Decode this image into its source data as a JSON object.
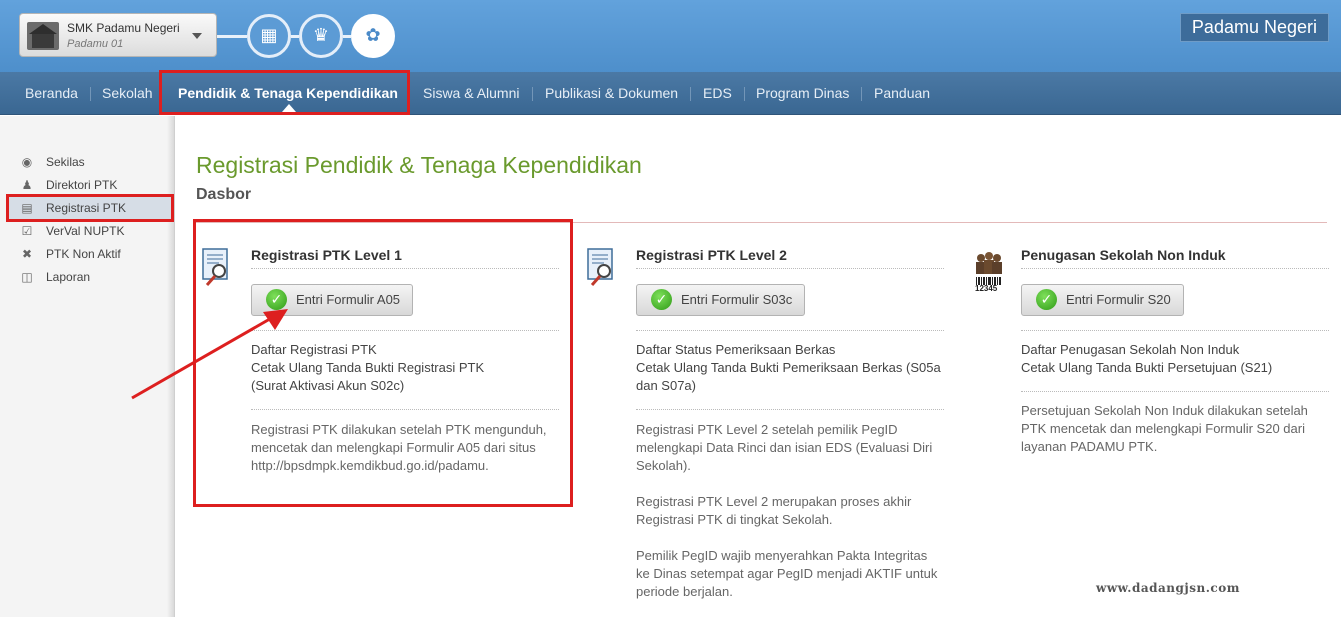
{
  "header": {
    "school_name": "SMK Padamu Negeri",
    "school_sub": "Padamu 01",
    "brand": "Padamu Negeri",
    "steps": [
      {
        "icon": "building-icon",
        "active": false
      },
      {
        "icon": "crown-icon",
        "active": false
      },
      {
        "icon": "badge-icon",
        "active": true
      }
    ]
  },
  "nav": {
    "items": [
      {
        "label": "Beranda"
      },
      {
        "label": "Sekolah"
      },
      {
        "label": "Pendidik & Tenaga Kependidikan",
        "active": true
      },
      {
        "label": "Siswa & Alumni"
      },
      {
        "label": "Publikasi & Dokumen"
      },
      {
        "label": "EDS"
      },
      {
        "label": "Program Dinas"
      },
      {
        "label": "Panduan"
      }
    ]
  },
  "sidebar": {
    "items": [
      {
        "label": "Sekilas",
        "icon": "info-icon"
      },
      {
        "label": "Direktori PTK",
        "icon": "person-icon"
      },
      {
        "label": "Registrasi PTK",
        "icon": "id-card-icon",
        "active": true
      },
      {
        "label": "VerVal NUPTK",
        "icon": "clipboard-check-icon"
      },
      {
        "label": "PTK Non Aktif",
        "icon": "cross-icon"
      },
      {
        "label": "Laporan",
        "icon": "document-icon"
      }
    ]
  },
  "main": {
    "title": "Registrasi Pendidik & Tenaga Kependidikan",
    "section": "Dasbor",
    "cards": [
      {
        "title": "Registrasi PTK Level 1",
        "button": "Entri Formulir A05",
        "links": [
          "Daftar Registrasi PTK",
          "Cetak Ulang Tanda Bukti Registrasi PTK",
          "(Surat Aktivasi Akun S02c)"
        ],
        "desc": [
          "Registrasi PTK dilakukan setelah PTK mengunduh,",
          "mencetak dan melengkapi Formulir A05 dari situs",
          "http://bpsdmpk.kemdikbud.go.id/padamu."
        ]
      },
      {
        "title": "Registrasi PTK Level 2",
        "button": "Entri Formulir S03c",
        "links": [
          "Daftar Status Pemeriksaan Berkas",
          "Cetak Ulang Tanda Bukti Pemeriksaan Berkas (S05a",
          "dan S07a)"
        ],
        "desc": [
          "Registrasi PTK Level 2 setelah pemilik PegID",
          "melengkapi Data Rinci dan isian EDS (Evaluasi Diri",
          "Sekolah).",
          "",
          "Registrasi PTK Level 2 merupakan proses akhir",
          "Registrasi PTK di tingkat Sekolah.",
          "",
          "Pemilik PegID wajib menyerahkan Pakta Integritas",
          "ke Dinas setempat agar PegID menjadi AKTIF untuk",
          "periode berjalan."
        ]
      },
      {
        "title": "Penugasan Sekolah Non Induk",
        "button": "Entri Formulir S20",
        "links": [
          "Daftar Penugasan Sekolah Non Induk",
          "Cetak Ulang Tanda Bukti Persetujuan (S21)"
        ],
        "desc": [
          "Persetujuan Sekolah Non Induk dilakukan setelah",
          "PTK mencetak dan melengkapi Formulir S20 dari",
          "layanan PADAMU PTK."
        ],
        "icon_caption": "12345"
      }
    ]
  },
  "watermark": "www.dadangjsn.com",
  "colors": {
    "accent_green": "#6a9a2d",
    "nav_blue": "#3f6d99",
    "highlight_red": "#dd1f1f"
  }
}
